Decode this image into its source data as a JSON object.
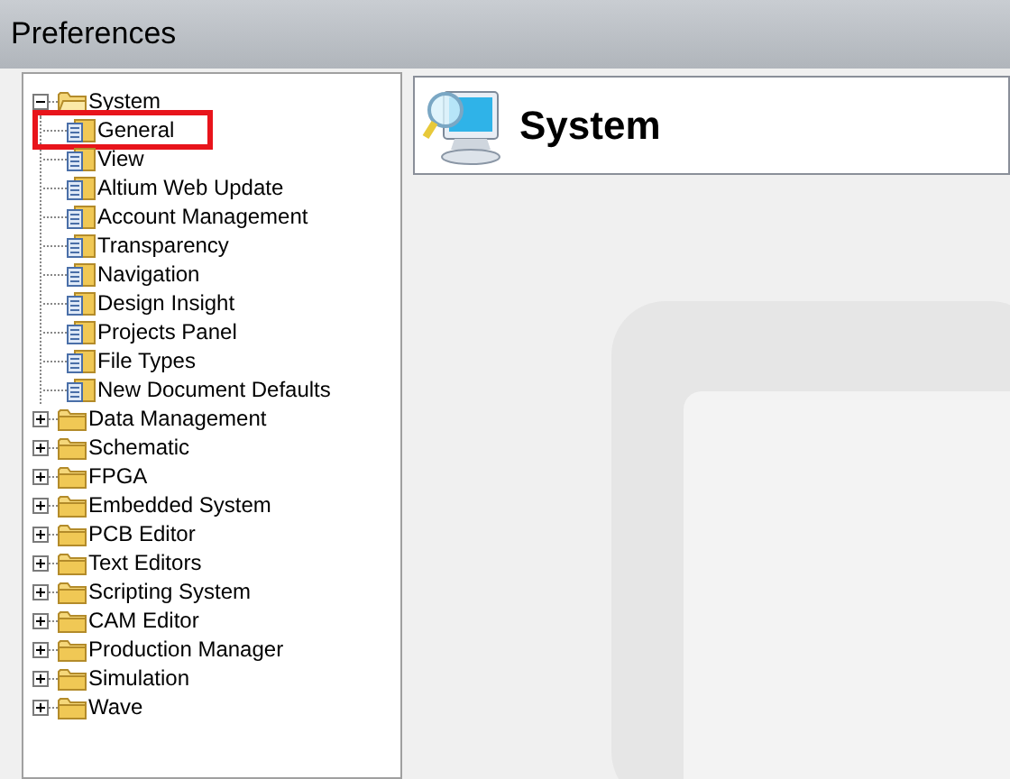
{
  "window": {
    "title": "Preferences"
  },
  "tree": [
    {
      "label": "System",
      "expanded": true,
      "children": [
        {
          "label": "General",
          "highlighted": true
        },
        {
          "label": "View",
          "highlighted": false
        },
        {
          "label": "Altium Web Update",
          "highlighted": false
        },
        {
          "label": "Account Management",
          "highlighted": false
        },
        {
          "label": "Transparency",
          "highlighted": false
        },
        {
          "label": "Navigation",
          "highlighted": false
        },
        {
          "label": "Design Insight",
          "highlighted": false
        },
        {
          "label": "Projects Panel",
          "highlighted": false
        },
        {
          "label": "File Types",
          "highlighted": false
        },
        {
          "label": "New Document Defaults",
          "highlighted": false
        }
      ]
    },
    {
      "label": "Data Management",
      "expanded": false
    },
    {
      "label": "Schematic",
      "expanded": false
    },
    {
      "label": "FPGA",
      "expanded": false
    },
    {
      "label": "Embedded System",
      "expanded": false
    },
    {
      "label": "PCB Editor",
      "expanded": false
    },
    {
      "label": "Text Editors",
      "expanded": false
    },
    {
      "label": "Scripting System",
      "expanded": false
    },
    {
      "label": "CAM Editor",
      "expanded": false
    },
    {
      "label": "Production Manager",
      "expanded": false
    },
    {
      "label": "Simulation",
      "expanded": false
    },
    {
      "label": "Wave",
      "expanded": false
    }
  ],
  "page_header": {
    "title": "System"
  }
}
